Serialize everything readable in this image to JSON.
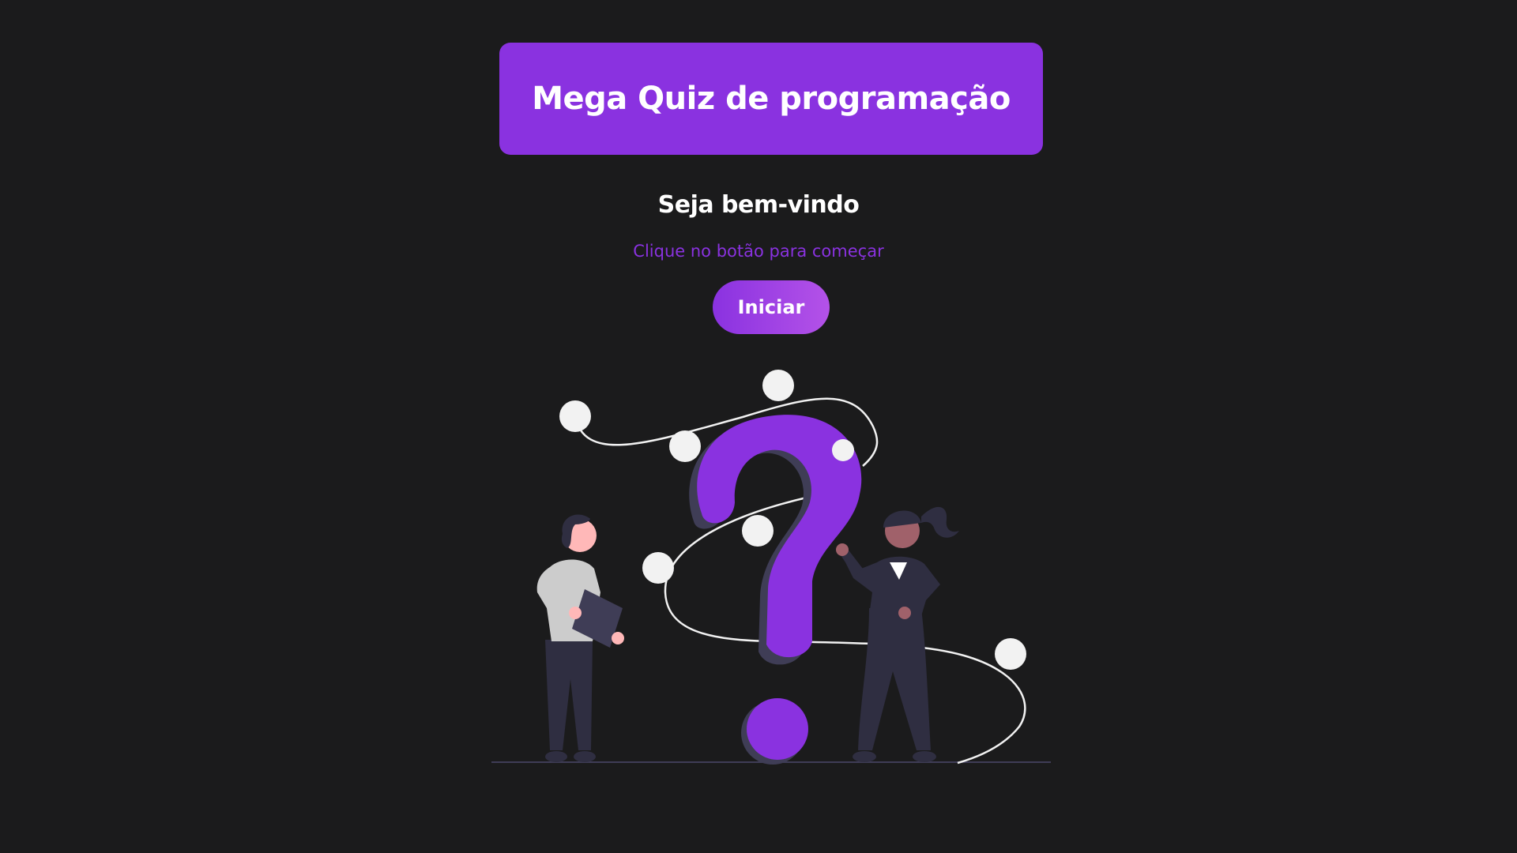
{
  "header": {
    "title": "Mega Quiz de programação"
  },
  "welcome": {
    "heading": "Seja bem-vindo",
    "instruction": "Clique no botão para começar",
    "start_label": "Iniciar"
  },
  "colors": {
    "background": "#1b1b1c",
    "accent": "#8a32e0",
    "accent_light": "#b452e8",
    "text": "#ffffff",
    "illustration_dark": "#2f2e41",
    "illustration_node": "#f2f2f2"
  },
  "illustration": {
    "icon": "question-mark-people-illustration"
  }
}
